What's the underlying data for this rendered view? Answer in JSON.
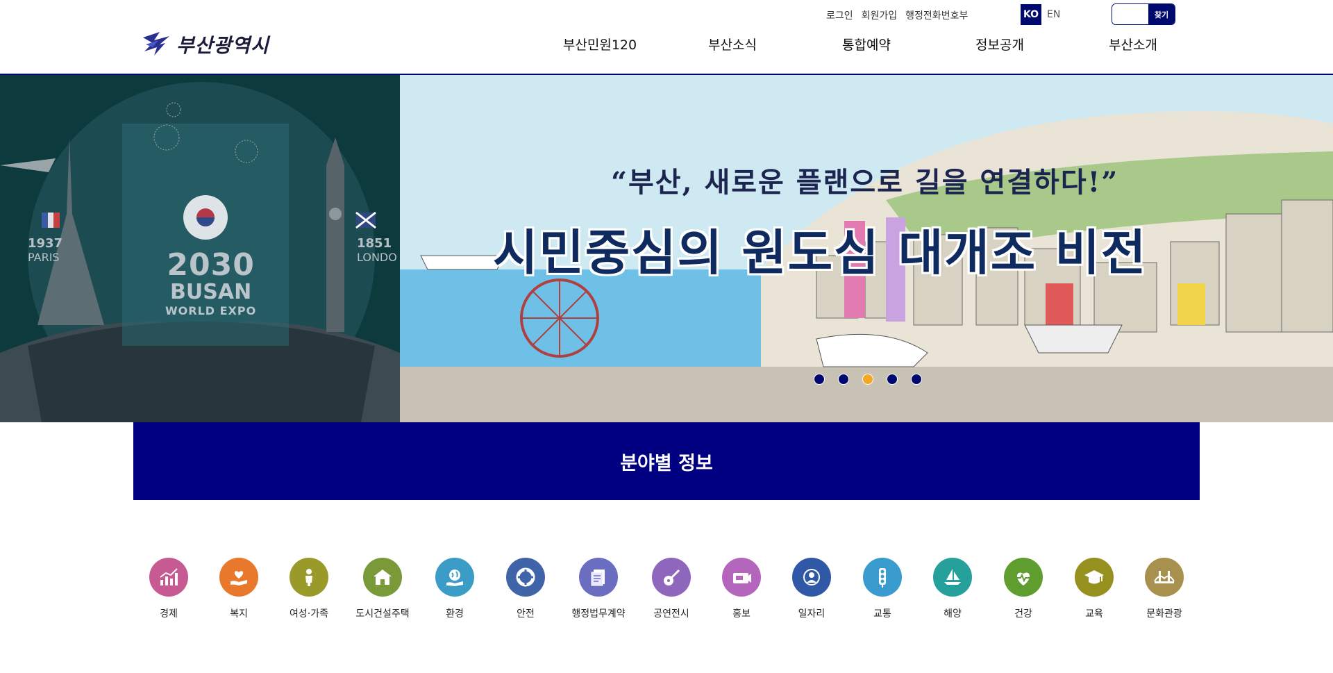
{
  "header": {
    "logo_text": "부산광역시",
    "util_links": [
      "로그인",
      "회원가입",
      "행정전화번호부"
    ],
    "lang": {
      "ko": "KO",
      "en": "EN"
    },
    "search": {
      "button": "찾기",
      "value": ""
    },
    "nav": [
      "부산민원120",
      "부산소식",
      "통합예약",
      "정보공개",
      "부산소개"
    ],
    "colors": {
      "brand": "#000a6e"
    }
  },
  "hero": {
    "slogan": "“부산, 새로운 플랜으로 길을 연결하다!”",
    "headline": "시민중심의 원도심 대개조 비전",
    "expo": {
      "year": "2030",
      "city": "BUSAN",
      "event": "WORLD EXPO"
    },
    "paris": {
      "year": "1937",
      "city": "PARIS"
    },
    "london": {
      "year": "1851",
      "city": "LONDO"
    },
    "slides": {
      "count": 5,
      "active": 3
    },
    "colors": {
      "dot": "#000a6e",
      "dot_active": "#f5a623"
    }
  },
  "categories": {
    "title": "분야별 정보",
    "bar_color": "#000080",
    "items": [
      {
        "label": "경제",
        "icon": "chart-icon",
        "color": "#c75a93"
      },
      {
        "label": "복지",
        "icon": "heart-hand-icon",
        "color": "#e8792c"
      },
      {
        "label": "여성·가족",
        "icon": "person-icon",
        "color": "#9a9a2a"
      },
      {
        "label": "도시건설주택",
        "icon": "house-icon",
        "color": "#7a9a3a"
      },
      {
        "label": "환경",
        "icon": "globe-hand-icon",
        "color": "#3c9cc8"
      },
      {
        "label": "안전",
        "icon": "lifebuoy-icon",
        "color": "#3f64a8"
      },
      {
        "label": "행정법무계약",
        "icon": "document-icon",
        "color": "#6b6ec0"
      },
      {
        "label": "공연전시",
        "icon": "guitar-icon",
        "color": "#8e67bd"
      },
      {
        "label": "홍보",
        "icon": "megaphone-icon",
        "color": "#b466bd"
      },
      {
        "label": "일자리",
        "icon": "worker-icon",
        "color": "#2f58a6"
      },
      {
        "label": "교통",
        "icon": "traffic-light-icon",
        "color": "#3a9bcf"
      },
      {
        "label": "해양",
        "icon": "sailboat-icon",
        "color": "#26a09a"
      },
      {
        "label": "건강",
        "icon": "health-heart-icon",
        "color": "#5f9e2e"
      },
      {
        "label": "교육",
        "icon": "graduation-cap-icon",
        "color": "#96911e"
      },
      {
        "label": "문화관광",
        "icon": "bridge-icon",
        "color": "#a8904f"
      }
    ]
  }
}
